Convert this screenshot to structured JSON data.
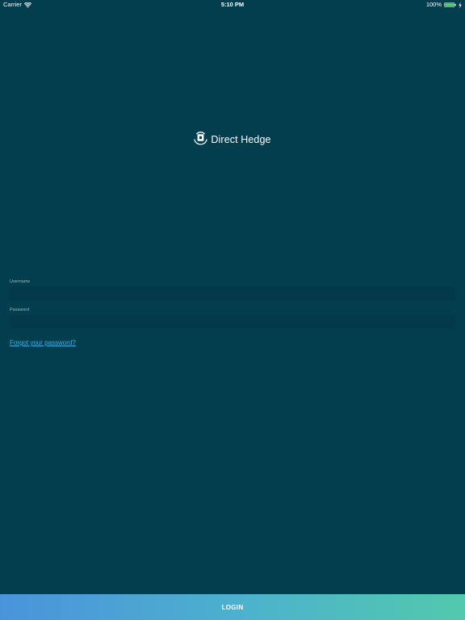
{
  "status_bar": {
    "carrier": "Carrier",
    "time": "5:10 PM",
    "battery_percent": "100%",
    "icons": [
      "wifi-icon",
      "battery-icon",
      "charging-icon"
    ]
  },
  "logo": {
    "text": "Direct Hedge",
    "icon": "direct-hedge-logo-icon"
  },
  "form": {
    "username_label": "Username",
    "username_value": "",
    "password_label": "Password",
    "password_value": "",
    "forgot_password": "Forgot your password?"
  },
  "login_button": {
    "label": "LOGIN"
  },
  "colors": {
    "background": "#023e4e",
    "input_background": "#03394a",
    "link": "#3cb3dc",
    "button_gradient_start": "#4a93dc",
    "button_gradient_end": "#52c9ad",
    "battery": "#4cd964"
  }
}
